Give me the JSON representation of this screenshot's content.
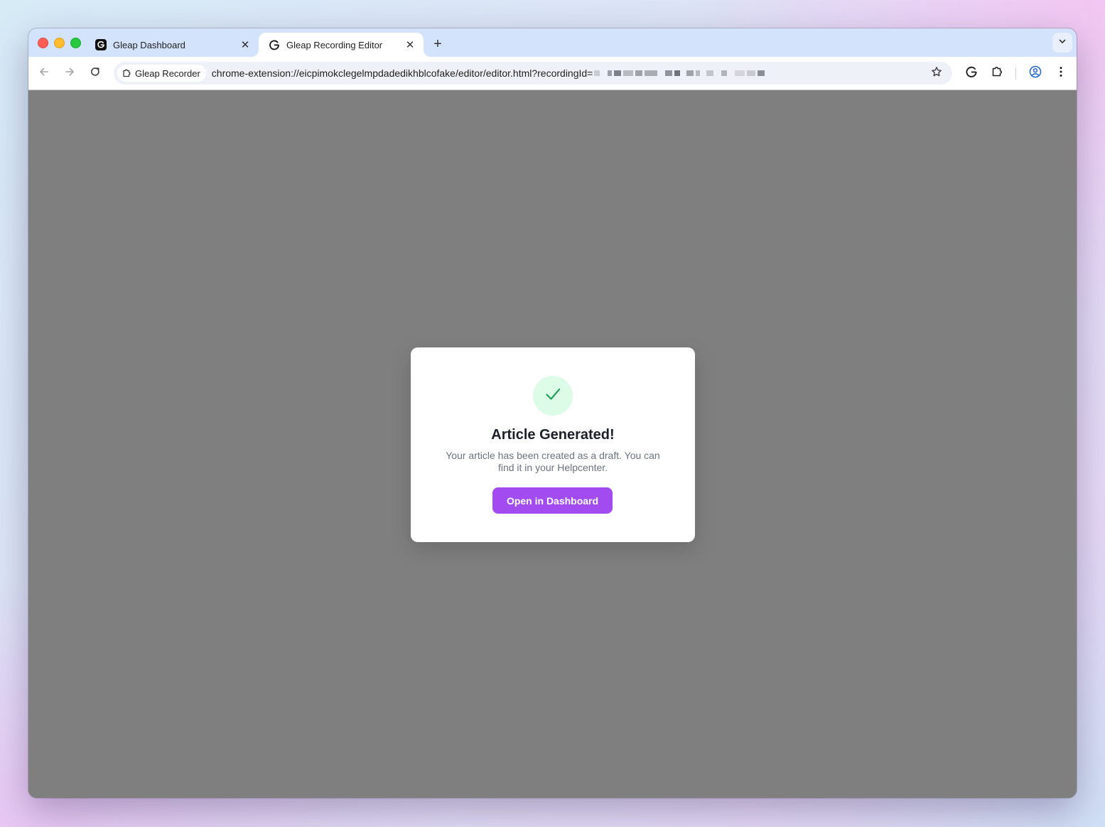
{
  "browser": {
    "tabs": [
      {
        "title": "Gleap Dashboard",
        "close": "✕",
        "active": false
      },
      {
        "title": "Gleap Recording Editor",
        "close": "✕",
        "active": true
      }
    ],
    "new_tab": "+",
    "omnibox": {
      "chip_label": "Gleap Recorder",
      "url": "chrome-extension://eicpimokclegelmpdadedikhblcofake/editor/editor.html?recordingId="
    }
  },
  "modal": {
    "title": "Article Generated!",
    "description": "Your article has been created as a draft. You can find it in your Helpcenter.",
    "button_label": "Open in Dashboard"
  },
  "colors": {
    "accent": "#a24bf0",
    "success_bg": "#dcfce7",
    "success_check": "#22a05a",
    "overlay": "#7f7f80"
  }
}
